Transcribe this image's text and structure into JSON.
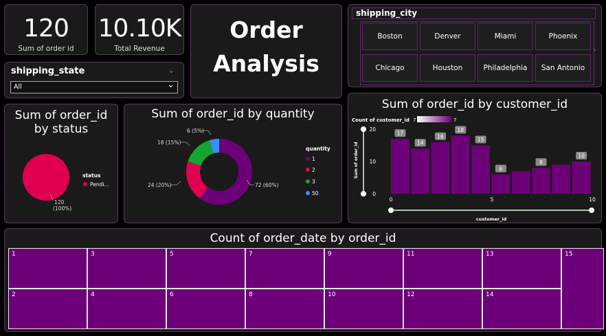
{
  "kpis": {
    "orders": {
      "value": "120",
      "label": "Sum of order id"
    },
    "revenue": {
      "value": "10.10K",
      "label": "Total Revenue"
    }
  },
  "title": {
    "line1": "Order",
    "line2": "Analysis"
  },
  "state_slicer": {
    "title": "shipping_state",
    "selected": "All"
  },
  "city_slicer": {
    "title": "shipping_city",
    "cities": [
      "Boston",
      "Denver",
      "Miami",
      "Phoenix",
      "Chicago",
      "Houston",
      "Philadelphia",
      "San Antonio"
    ]
  },
  "colors": {
    "purple": "#6d0079",
    "pink": "#e0004f",
    "green": "#12a630",
    "blue": "#3a8ef5"
  },
  "chart_data": [
    {
      "type": "pie",
      "title_line1": "Sum of order_id",
      "title_line2": "by status",
      "legend_title": "status",
      "legend_items": [
        "Pendi..."
      ],
      "slices": [
        {
          "name": "Pending",
          "value": 120,
          "percent": "100%"
        }
      ],
      "data_labels": [
        "120",
        "(100%)"
      ]
    },
    {
      "type": "pie",
      "title": "Sum of order_id by quantity",
      "legend_title": "quantity",
      "categories": [
        "1",
        "2",
        "3",
        "50"
      ],
      "values": [
        72,
        24,
        18,
        6
      ],
      "data_labels": [
        "72 (60%)",
        "24 (20%)",
        "18 (15%)",
        "6 (5%)"
      ]
    },
    {
      "type": "bar",
      "title": "Sum of order_id by customer_id",
      "xlabel": "customer_id",
      "ylabel": "Sum of order_id",
      "color_legend_label": "Count of customer_id",
      "color_legend_min": "7",
      "color_legend_max": "7",
      "x": [
        1,
        2,
        3,
        4,
        5,
        6,
        7,
        8,
        9,
        10
      ],
      "values": [
        17,
        14,
        16,
        18,
        15,
        6,
        7,
        8,
        9,
        10
      ],
      "data_labels": [
        "17",
        "14",
        "16",
        "18",
        "15",
        "6",
        "",
        "8",
        "",
        "10"
      ],
      "xticks": [
        "0",
        "5",
        "10"
      ],
      "yticks": [
        "0",
        "10",
        "20"
      ],
      "ylim": [
        0,
        20
      ]
    },
    {
      "type": "heatmap",
      "title": "Count of order_date by order_id",
      "cells": [
        {
          "label": "1"
        },
        {
          "label": "2"
        },
        {
          "label": "3"
        },
        {
          "label": "4"
        },
        {
          "label": "5"
        },
        {
          "label": "6"
        },
        {
          "label": "7"
        },
        {
          "label": "8"
        },
        {
          "label": "9"
        },
        {
          "label": "10"
        },
        {
          "label": "11"
        },
        {
          "label": "12"
        },
        {
          "label": "13"
        },
        {
          "label": "14"
        },
        {
          "label": "15"
        }
      ]
    }
  ]
}
